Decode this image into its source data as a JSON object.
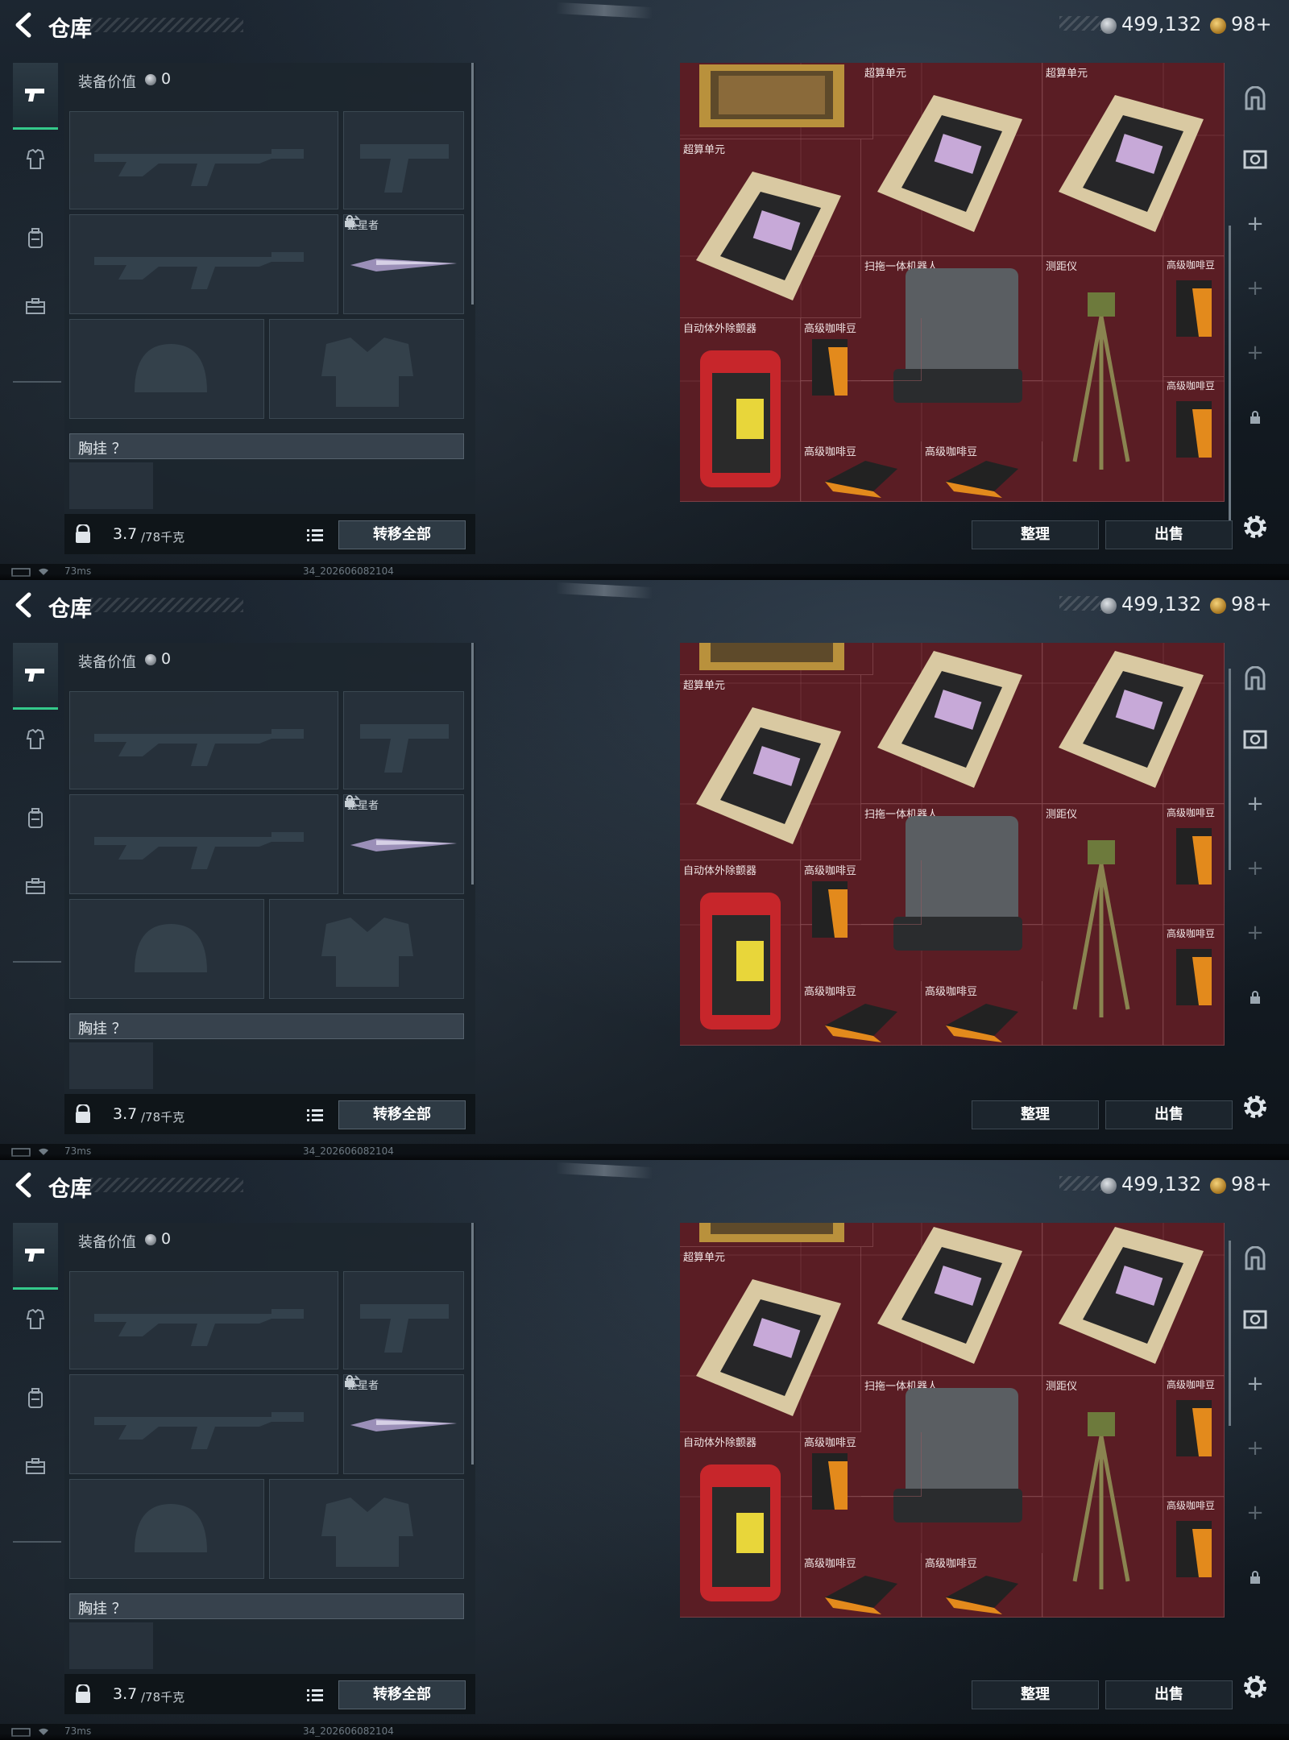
{
  "frames": [
    {
      "header": {
        "title": "仓库",
        "silver": "499,132",
        "gold": "98+"
      },
      "equipment": {
        "value_label": "装备价值",
        "value": "0",
        "melee_label": "坠星者",
        "chest_label": "胸挂 ？",
        "weight_current": "3.7",
        "weight_max": "/78千克",
        "transfer_all": "转移全部"
      },
      "storage": {
        "items": [
          "超算单元",
          "超算单元",
          "超算单元",
          "扫拖一体机器人",
          "测距仪",
          "高级咖啡豆",
          "自动体外除颤器",
          "高级咖啡豆",
          "高级咖啡豆",
          "高级咖啡豆",
          "高级咖啡豆"
        ],
        "sort": "整理",
        "sell": "出售"
      },
      "status": {
        "latency": "73ms",
        "build": "34_202606082104"
      }
    },
    {
      "header": {
        "title": "仓库",
        "silver": "499,132",
        "gold": "98+"
      },
      "equipment": {
        "value_label": "装备价值",
        "value": "0",
        "melee_label": "坠星者",
        "chest_label": "胸挂 ？",
        "weight_current": "3.7",
        "weight_max": "/78千克",
        "transfer_all": "转移全部"
      },
      "storage": {
        "items": [
          "超算单元",
          "扫拖一体机器人",
          "测距仪",
          "高级咖啡豆",
          "自动体外除颤器",
          "高级咖啡豆",
          "高级咖啡豆",
          "高级咖啡豆",
          "高级咖啡豆"
        ],
        "sort": "整理",
        "sell": "出售"
      },
      "status": {
        "latency": "73ms",
        "build": "34_202606082104"
      }
    },
    {
      "header": {
        "title": "仓库",
        "silver": "499,132",
        "gold": "98+"
      },
      "equipment": {
        "value_label": "装备价值",
        "value": "0",
        "melee_label": "坠星者",
        "chest_label": "胸挂 ？",
        "weight_current": "3.7",
        "weight_max": "/78千克",
        "transfer_all": "转移全部"
      },
      "storage": {
        "items": [
          "超算单元",
          "扫拖一体机器人",
          "测距仪",
          "高级咖啡豆",
          "自动体外除颤器",
          "高级咖啡豆",
          "高级咖啡豆",
          "高级咖啡豆",
          "高级咖啡豆"
        ],
        "sort": "整理",
        "sell": "出售"
      },
      "status": {
        "latency": "73ms",
        "build": "34_202606082104"
      }
    }
  ],
  "colors": {
    "accent": "#34c98a",
    "storage_bg": "#5a1d24",
    "panel": "#1c252d"
  },
  "icons": [
    "back-arrow-icon",
    "silver-coin-icon",
    "gold-coin-icon",
    "pistol-icon",
    "armor-icon",
    "backpack-icon",
    "case-icon",
    "helmet-icon",
    "vest-icon",
    "lock-icon",
    "swap-icon",
    "list-icon",
    "gear-icon",
    "plus-icon"
  ]
}
